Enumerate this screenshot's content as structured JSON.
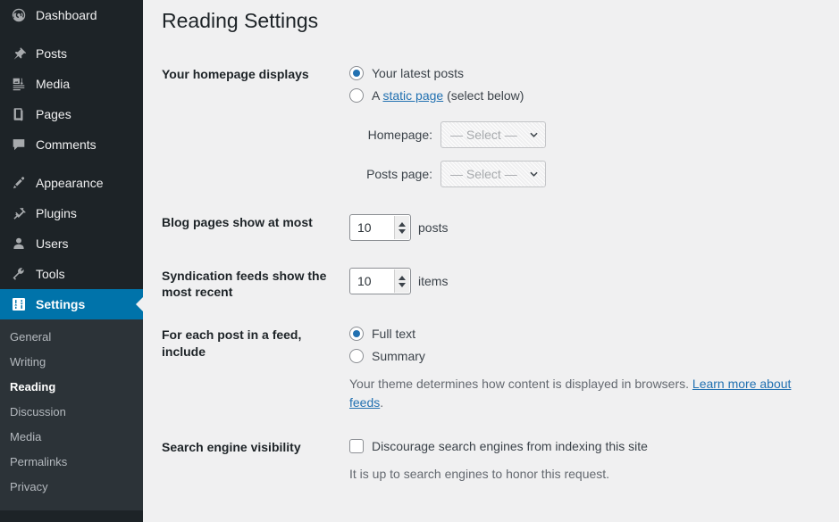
{
  "sidebar": {
    "groups": [
      {
        "items": [
          {
            "label": "Dashboard",
            "icon": "dashboard-icon",
            "name": "sidebar-item-dashboard",
            "current": false
          }
        ]
      },
      {
        "items": [
          {
            "label": "Posts",
            "icon": "pin-icon",
            "name": "sidebar-item-posts",
            "current": false
          },
          {
            "label": "Media",
            "icon": "media-icon",
            "name": "sidebar-item-media",
            "current": false
          },
          {
            "label": "Pages",
            "icon": "pages-icon",
            "name": "sidebar-item-pages",
            "current": false
          },
          {
            "label": "Comments",
            "icon": "comment-icon",
            "name": "sidebar-item-comments",
            "current": false
          }
        ]
      },
      {
        "items": [
          {
            "label": "Appearance",
            "icon": "paintbrush-icon",
            "name": "sidebar-item-appearance",
            "current": false
          },
          {
            "label": "Plugins",
            "icon": "plug-icon",
            "name": "sidebar-item-plugins",
            "current": false
          },
          {
            "label": "Users",
            "icon": "user-icon",
            "name": "sidebar-item-users",
            "current": false
          },
          {
            "label": "Tools",
            "icon": "wrench-icon",
            "name": "sidebar-item-tools",
            "current": false
          },
          {
            "label": "Settings",
            "icon": "sliders-icon",
            "name": "sidebar-item-settings",
            "current": true
          }
        ]
      }
    ],
    "submenu": [
      {
        "label": "General",
        "name": "submenu-item-general",
        "current": false
      },
      {
        "label": "Writing",
        "name": "submenu-item-writing",
        "current": false
      },
      {
        "label": "Reading",
        "name": "submenu-item-reading",
        "current": true
      },
      {
        "label": "Discussion",
        "name": "submenu-item-discussion",
        "current": false
      },
      {
        "label": "Media",
        "name": "submenu-item-media",
        "current": false
      },
      {
        "label": "Permalinks",
        "name": "submenu-item-permalinks",
        "current": false
      },
      {
        "label": "Privacy",
        "name": "submenu-item-privacy",
        "current": false
      }
    ],
    "colors": {
      "background": "#1d2327",
      "submenu_background": "#2c3338",
      "current_highlight": "#0073aa"
    }
  },
  "page": {
    "title": "Reading Settings",
    "accent": "#2271b1"
  },
  "homepage_displays": {
    "label": "Your homepage displays",
    "options": [
      {
        "label": "Your latest posts",
        "checked": true
      },
      {
        "label_prefix": "A ",
        "link": "static page",
        "label_suffix": " (select below)",
        "checked": false
      }
    ],
    "homepage": {
      "label": "Homepage:",
      "value": "— Select —",
      "disabled": true
    },
    "posts_page": {
      "label": "Posts page:",
      "value": "— Select —",
      "disabled": true
    }
  },
  "blog_pages": {
    "label": "Blog pages show at most",
    "value": "10",
    "unit": "posts"
  },
  "syndication_feeds": {
    "label": "Syndication feeds show the most recent",
    "value": "10",
    "unit": "items"
  },
  "feed_include": {
    "label": "For each post in a feed, include",
    "options": [
      {
        "label": "Full text",
        "checked": true
      },
      {
        "label": "Summary",
        "checked": false
      }
    ],
    "help_prefix": "Your theme determines how content is displayed in browsers. ",
    "help_link": "Learn more about feeds",
    "help_suffix": "."
  },
  "search_engine_visibility": {
    "label": "Search engine visibility",
    "checkbox_label": "Discourage search engines from indexing this site",
    "checked": false,
    "help": "It is up to search engines to honor this request."
  }
}
